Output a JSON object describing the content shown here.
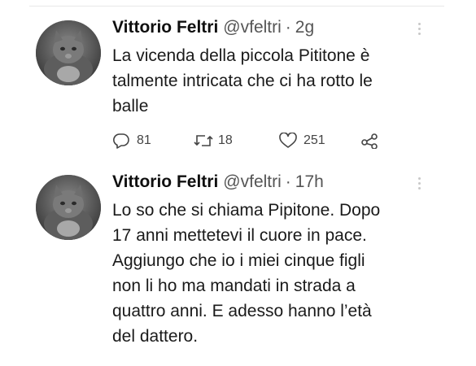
{
  "tweets": [
    {
      "author_name": "Vittorio Feltri",
      "handle": "@vfeltri",
      "separator": "·",
      "time": "2g",
      "text": "La vicenda della piccola Pititone è\ntalmente intricata che ci ha rotto le\nballe",
      "replies": "81",
      "retweets": "18",
      "likes": "251"
    },
    {
      "author_name": "Vittorio Feltri",
      "handle": "@vfeltri",
      "separator": "·",
      "time": "17h",
      "text": "Lo so che si chiama Pipitone. Dopo\n17 anni mettetevi il cuore in pace.\nAggiungo che io i miei cinque figli\nnon li ho ma mandati in strada a\nquattro anni. E adesso hanno l’età\ndel dattero."
    }
  ],
  "icons": {
    "avatar": "cat-photo",
    "more": "more-vertical-icon",
    "reply": "reply-icon",
    "retweet": "retweet-icon",
    "like": "heart-icon",
    "share": "share-icon"
  },
  "colors": {
    "text": "#1a1a1a",
    "secondary": "#555555",
    "background": "#ffffff"
  }
}
